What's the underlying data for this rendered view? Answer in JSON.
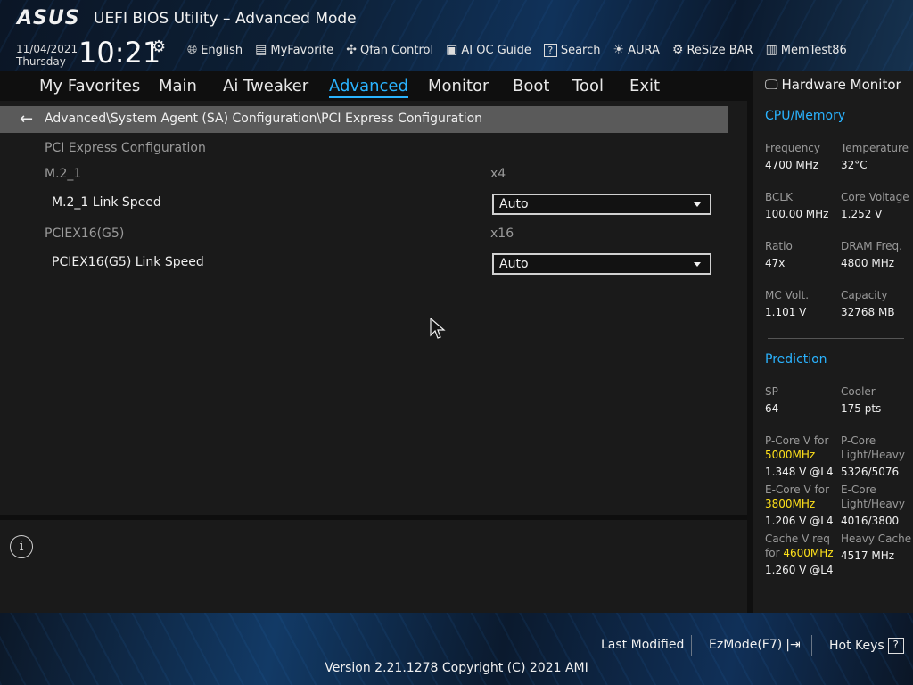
{
  "header": {
    "logo": "ASUS",
    "title": "UEFI BIOS Utility – Advanced Mode",
    "date": "11/04/2021",
    "day": "Thursday",
    "time": "10:21"
  },
  "toolbar": [
    {
      "icon": "globe-icon",
      "label": "English"
    },
    {
      "icon": "favorite-icon",
      "label": "MyFavorite"
    },
    {
      "icon": "fan-icon",
      "label": "Qfan Control"
    },
    {
      "icon": "chip-icon",
      "label": "AI OC Guide"
    },
    {
      "icon": "question-icon",
      "label": "Search"
    },
    {
      "icon": "aura-icon",
      "label": "AURA"
    },
    {
      "icon": "resize-bar-icon",
      "label": "ReSize BAR"
    },
    {
      "icon": "memtest-icon",
      "label": "MemTest86"
    }
  ],
  "menu": {
    "items": [
      "My Favorites",
      "Main",
      "Ai Tweaker",
      "Advanced",
      "Monitor",
      "Boot",
      "Tool",
      "Exit"
    ],
    "active": "Advanced"
  },
  "breadcrumb": "Advanced\\System Agent (SA) Configuration\\PCI Express Configuration",
  "content": {
    "section_title": "PCI Express Configuration",
    "m2_label": "M.2_1",
    "m2_value": "x4",
    "m2_speed_label": "M.2_1 Link Speed",
    "m2_speed_value": "Auto",
    "pcie_label": "PCIEX16(G5)",
    "pcie_value": "x16",
    "pcie_speed_label": "PCIEX16(G5) Link Speed",
    "pcie_speed_value": "Auto"
  },
  "hw_monitor": {
    "title": "Hardware Monitor",
    "cpu_section": "CPU/Memory",
    "frequency_label": "Frequency",
    "frequency": "4700 MHz",
    "temperature_label": "Temperature",
    "temperature": "32°C",
    "bclk_label": "BCLK",
    "bclk": "100.00 MHz",
    "core_voltage_label": "Core Voltage",
    "core_voltage": "1.252 V",
    "ratio_label": "Ratio",
    "ratio": "47x",
    "dram_freq_label": "DRAM Freq.",
    "dram_freq": "4800 MHz",
    "mc_volt_label": "MC Volt.",
    "mc_volt": "1.101 V",
    "capacity_label": "Capacity",
    "capacity": "32768 MB",
    "prediction_section": "Prediction",
    "sp_label": "SP",
    "sp": "64",
    "cooler_label": "Cooler",
    "cooler": "175 pts",
    "pcore_v_label": "P-Core V for",
    "pcore_v_freq": "5000MHz",
    "pcore_v": "1.348 V @L4",
    "pcore_lh_label1": "P-Core",
    "pcore_lh_label2": "Light/Heavy",
    "pcore_lh": "5326/5076",
    "ecore_v_label": "E-Core V for",
    "ecore_v_freq": "3800MHz",
    "ecore_v": "1.206 V @L4",
    "ecore_lh_label1": "E-Core",
    "ecore_lh_label2": "Light/Heavy",
    "ecore_lh": "4016/3800",
    "cache_v_label1": "Cache V req",
    "cache_v_label2": "for",
    "cache_v_freq": "4600MHz",
    "cache_v": "1.260 V @L4",
    "heavy_cache_label": "Heavy Cache",
    "heavy_cache": "4517 MHz"
  },
  "footer": {
    "last_modified": "Last Modified",
    "ezmode": "EzMode(F7)",
    "hotkeys": "Hot Keys",
    "hotkeys_key": "?",
    "version": "Version 2.21.1278 Copyright (C) 2021 AMI"
  },
  "colors": {
    "accent": "#2ab3ff",
    "highlight": "#ffe11a"
  }
}
